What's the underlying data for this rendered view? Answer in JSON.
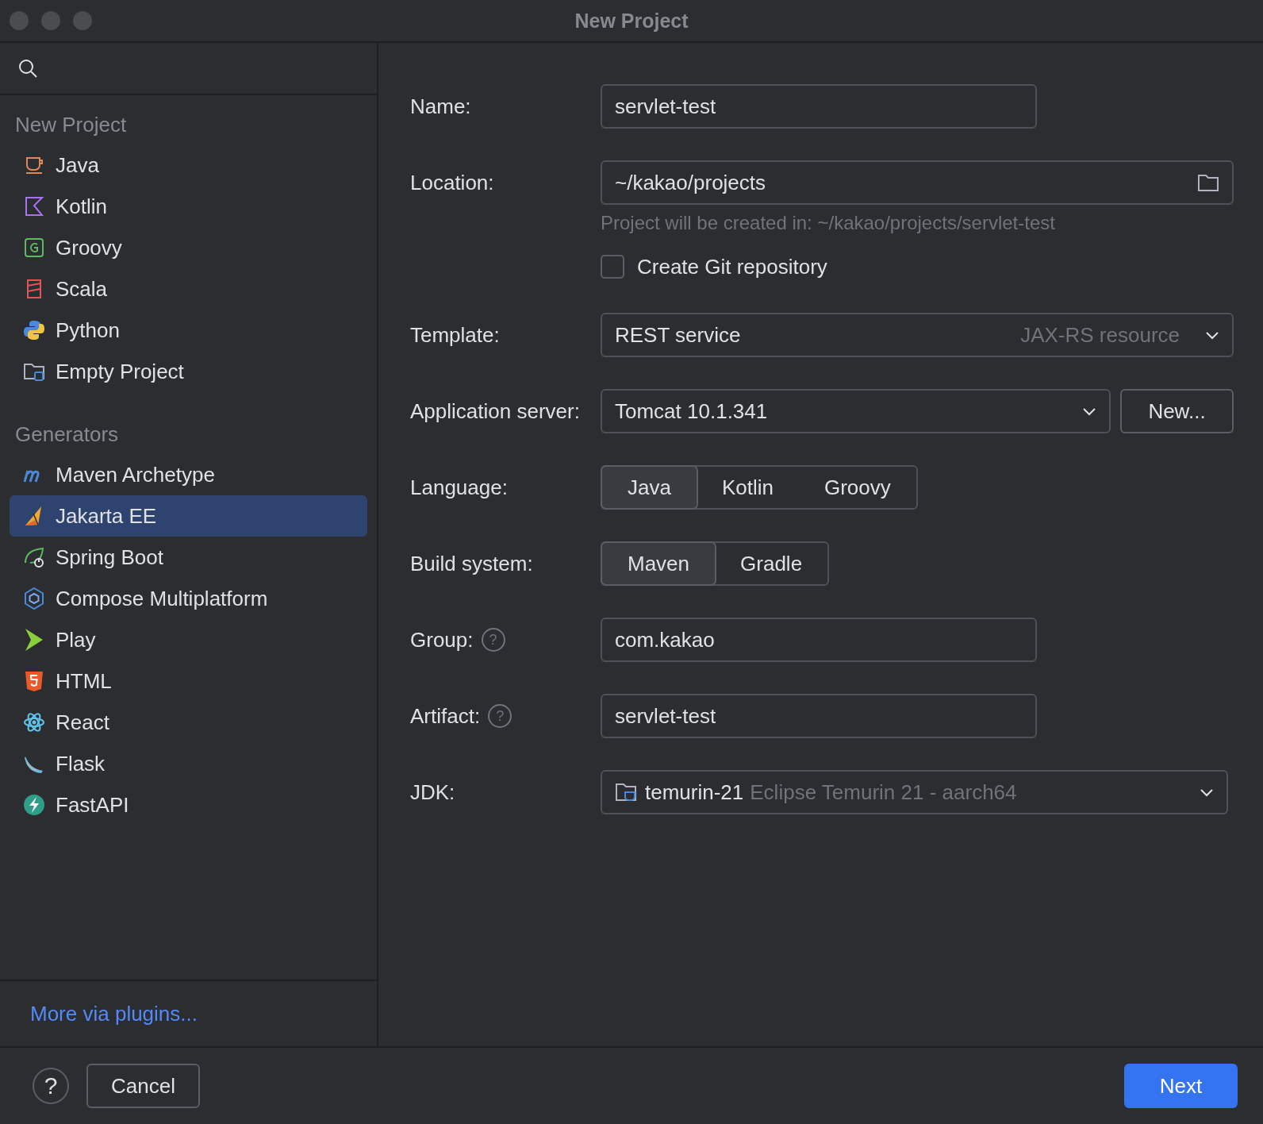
{
  "window": {
    "title": "New Project"
  },
  "sidebar": {
    "sections": [
      {
        "heading": "New Project",
        "items": [
          {
            "label": "Java",
            "selected": false
          },
          {
            "label": "Kotlin",
            "selected": false
          },
          {
            "label": "Groovy",
            "selected": false
          },
          {
            "label": "Scala",
            "selected": false
          },
          {
            "label": "Python",
            "selected": false
          },
          {
            "label": "Empty Project",
            "selected": false
          }
        ]
      },
      {
        "heading": "Generators",
        "items": [
          {
            "label": "Maven Archetype",
            "selected": false
          },
          {
            "label": "Jakarta EE",
            "selected": true
          },
          {
            "label": "Spring Boot",
            "selected": false
          },
          {
            "label": "Compose Multiplatform",
            "selected": false
          },
          {
            "label": "Play",
            "selected": false
          },
          {
            "label": "HTML",
            "selected": false
          },
          {
            "label": "React",
            "selected": false
          },
          {
            "label": "Flask",
            "selected": false
          },
          {
            "label": "FastAPI",
            "selected": false
          }
        ]
      }
    ],
    "more_link": "More via plugins..."
  },
  "form": {
    "name": {
      "label": "Name:",
      "value": "servlet-test"
    },
    "location": {
      "label": "Location:",
      "value": "~/kakao/projects",
      "hint": "Project will be created in: ~/kakao/projects/servlet-test"
    },
    "git": {
      "label": "Create Git repository",
      "checked": false
    },
    "template": {
      "label": "Template:",
      "value": "REST service",
      "hint": "JAX-RS resource"
    },
    "app_server": {
      "label": "Application server:",
      "value": "Tomcat 10.1.341",
      "button": "New..."
    },
    "language": {
      "label": "Language:",
      "options": [
        {
          "label": "Java",
          "selected": true
        },
        {
          "label": "Kotlin",
          "selected": false
        },
        {
          "label": "Groovy",
          "selected": false
        }
      ]
    },
    "build_system": {
      "label": "Build system:",
      "options": [
        {
          "label": "Maven",
          "selected": true
        },
        {
          "label": "Gradle",
          "selected": false
        }
      ]
    },
    "group": {
      "label": "Group:",
      "help": "?",
      "value": "com.kakao"
    },
    "artifact": {
      "label": "Artifact:",
      "help": "?",
      "value": "servlet-test"
    },
    "jdk": {
      "label": "JDK:",
      "name": "temurin-21",
      "description": "Eclipse Temurin 21 - aarch64"
    }
  },
  "footer": {
    "help": "?",
    "cancel": "Cancel",
    "next": "Next"
  }
}
